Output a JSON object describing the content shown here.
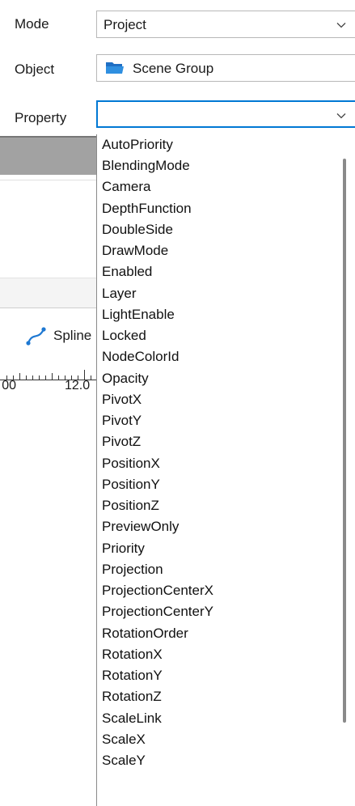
{
  "rows": {
    "mode": {
      "label": "Mode",
      "value": "Project"
    },
    "object": {
      "label": "Object",
      "value": "Scene Group"
    },
    "property": {
      "label": "Property",
      "value": ""
    }
  },
  "background_panel": {
    "spline_label": "Spline",
    "ruler_left": "00",
    "ruler_right": "12.0"
  },
  "property_options": [
    "AutoPriority",
    "BlendingMode",
    "Camera",
    "DepthFunction",
    "DoubleSide",
    "DrawMode",
    "Enabled",
    "Layer",
    "LightEnable",
    "Locked",
    "NodeColorId",
    "Opacity",
    "PivotX",
    "PivotY",
    "PivotZ",
    "PositionX",
    "PositionY",
    "PositionZ",
    "PreviewOnly",
    "Priority",
    "Projection",
    "ProjectionCenterX",
    "ProjectionCenterY",
    "RotationOrder",
    "RotationX",
    "RotationY",
    "RotationZ",
    "ScaleLink",
    "ScaleX",
    "ScaleY"
  ],
  "colors": {
    "focus_border": "#0078d4",
    "folder_icon": "#2f8fe0",
    "spline_icon": "#1e78d2"
  },
  "icons": {
    "mode_dropdown": "chevron-down-icon",
    "object_folder": "folder-icon",
    "property_dropdown": "chevron-down-icon",
    "spline": "spline-icon"
  }
}
